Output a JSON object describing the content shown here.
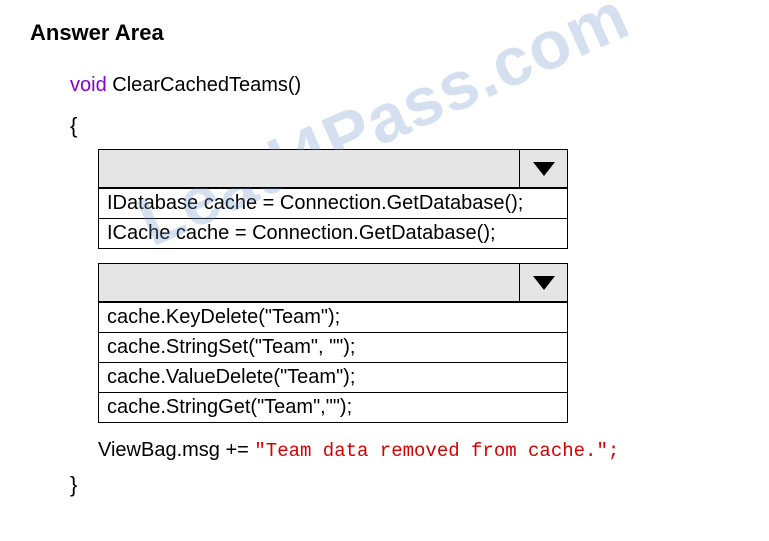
{
  "title": "Answer Area",
  "code": {
    "void_kw": "void",
    "fn_sig": " ClearCachedTeams()",
    "brace_open": "{",
    "brace_close": "}"
  },
  "dropdown1": {
    "options": [
      "IDatabase cache = Connection.GetDatabase();",
      "ICache cache = Connection.GetDatabase();"
    ]
  },
  "dropdown2": {
    "options": [
      "cache.KeyDelete(\"Team\");",
      "cache.StringSet(\"Team\", \"\");",
      "cache.ValueDelete(\"Team\");",
      "cache.StringGet(\"Team\",\"\");"
    ]
  },
  "viewbag": {
    "lhs": "ViewBag.msg += ",
    "str": "\"Team data removed from cache.\";"
  },
  "watermark": "Lead4Pass.com"
}
